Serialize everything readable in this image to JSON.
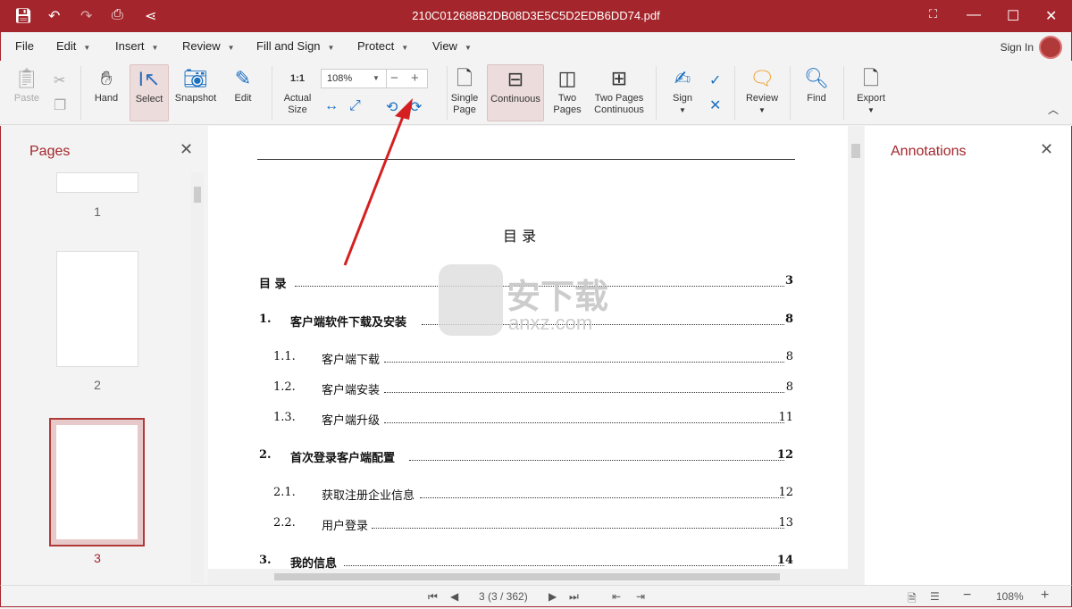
{
  "window": {
    "title": "210C012688B2DB08D3E5C5D2EDB6DD74.pdf",
    "accent": "#a4262c"
  },
  "menu": [
    "File",
    "Edit",
    "Insert",
    "Review",
    "Fill and Sign",
    "Protect",
    "View"
  ],
  "account": {
    "sign_in": "Sign In"
  },
  "ribbon": {
    "paste": "Paste",
    "hand": "Hand",
    "select": "Select",
    "snapshot": "Snapshot",
    "edit": "Edit",
    "actual_size": "Actual Size",
    "zoom": "108%",
    "single_page": "Single Page",
    "continuous": "Continuous",
    "two_pages": "Two Pages",
    "two_pages_continuous": "Two Pages Continuous",
    "sign": "Sign",
    "review": "Review",
    "find": "Find",
    "export": "Export"
  },
  "pages_panel": {
    "title": "Pages",
    "thumbs": [
      "1",
      "2",
      "3"
    ],
    "selected": "3"
  },
  "annotations_panel": {
    "title": "Annotations"
  },
  "document": {
    "heading": "目  录",
    "toc": [
      {
        "num": "目  录",
        "title": "",
        "page": "3",
        "level": 0
      },
      {
        "num": "1.",
        "title": "客户端软件下载及安装",
        "page": "8",
        "level": 1
      },
      {
        "num": "1.1.",
        "title": "客户端下载",
        "page": "8",
        "level": 2
      },
      {
        "num": "1.2.",
        "title": "客户端安装",
        "page": "8",
        "level": 2
      },
      {
        "num": "1.3.",
        "title": "客户端升级",
        "page": "11",
        "level": 2
      },
      {
        "num": "2.",
        "title": "首次登录客户端配置",
        "page": "12",
        "level": 1
      },
      {
        "num": "2.1.",
        "title": "获取注册企业信息",
        "page": "12",
        "level": 2
      },
      {
        "num": "2.2.",
        "title": "用户登录",
        "page": "13",
        "level": 2
      },
      {
        "num": "3.",
        "title": "我的信息",
        "page": "14",
        "level": 1
      }
    ],
    "watermark": "安下载 anxz.com"
  },
  "status": {
    "page": "3 (3 / 362)",
    "zoom": "108%"
  }
}
